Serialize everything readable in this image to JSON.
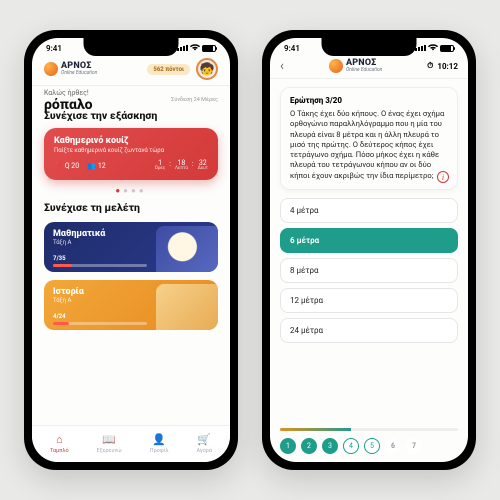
{
  "status": {
    "time": "9:41"
  },
  "brand": {
    "name": "ΑΡΝΟΣ",
    "tag": "Online Education"
  },
  "left": {
    "points": "562 πόντοι",
    "welcome": "Καλώς ήρθες!",
    "username": "ρόπαλο",
    "streak": "Σύνδεση 24 Μέρες",
    "section1": "Συνέχισε την εξάσκηση",
    "quiz": {
      "title": "Καθημερινό κουίζ",
      "subtitle": "Παίξτε καθημερινά κουίζ ζωντανά τώρα",
      "q_label": "Q 20",
      "players": "12",
      "cd_h": "1",
      "cd_m": "18",
      "cd_s": "32",
      "u_h": "Ώρες",
      "u_m": "Λεπτά",
      "u_s": "Δευτ"
    },
    "section2": "Συνέχισε τη μελέτη",
    "subjects": [
      {
        "title": "Μαθηματικά",
        "class": "Τάξη Α",
        "progress": "7/35",
        "pct": 20
      },
      {
        "title": "Ιστορία",
        "class": "Τάξη Α",
        "progress": "4/24",
        "pct": 17
      }
    ],
    "tabs": {
      "home": "Ταμπλό",
      "explore": "Εξερευνώ",
      "profile": "Προφίλ",
      "market": "Αγορά"
    }
  },
  "right": {
    "timer": "10:12",
    "qnum": "Ερώτηση 3/20",
    "question": "Ο Τάκης έχει δύο κήπους. Ο ένας έχει σχήμα ορθογώνιο παραλληλόγραμμο που η μία του πλευρά είναι 8 μέτρα και η άλλη πλευρά το μισό της πρώτης. Ο δεύτερος κήπος έχει τετράγωνο σχήμα. Πόσο μήκος έχει η κάθε πλευρά του τετράγωνου κήπου αν οι δύο κήποι έχουν ακριβώς την ίδια περίμετρο;",
    "answers": [
      "4 μέτρα",
      "6 μέτρα",
      "8 μέτρα",
      "12 μέτρα",
      "24 μέτρα"
    ],
    "selected": 1,
    "pager": [
      "1",
      "2",
      "3",
      "4",
      "5",
      "6",
      "7"
    ]
  }
}
